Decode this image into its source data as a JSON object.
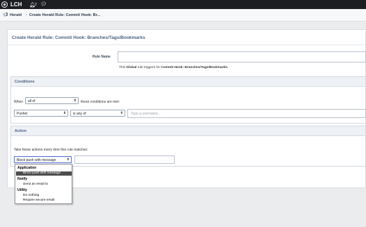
{
  "topbar": {
    "brand": "LCH",
    "notification_count": "2",
    "icons": {
      "logo": "eye-logo-icon",
      "bell": "bell-icon",
      "chat": "chat-icon"
    }
  },
  "breadcrumb": {
    "items": [
      "Herald",
      "Create Herald Rule: Commit Hook: Br..."
    ],
    "separator": "›"
  },
  "page": {
    "title": "Create Herald Rule: Commit Hook: Branches/Tags/Bookmarks"
  },
  "rule_name": {
    "label": "Rule Name",
    "value": "",
    "desc_prefix": "This ",
    "desc_scope": "Global",
    "desc_mid": " rule triggers for ",
    "desc_type": "Commit Hook: Branches/Tags/Bookmarks",
    "desc_end": "."
  },
  "conditions": {
    "header": "Conditions",
    "when_label": "When",
    "when_value": "all of",
    "when_suffix": "these conditions are met:",
    "field_value": "Pusher",
    "operator_value": "is any of",
    "token_placeholder": "Type a username..."
  },
  "action": {
    "header": "Action",
    "instructions": "Take these actions every time this rule matches:",
    "selected_action": "Block push with message",
    "message_value": "",
    "dropdown": [
      {
        "group": "Application",
        "options": [
          "Block push with message"
        ]
      },
      {
        "group": "Notify",
        "options": [
          "Send an email to"
        ]
      },
      {
        "group": "Utility",
        "options": [
          "Do nothing",
          "Require secure email"
        ]
      }
    ]
  },
  "colors": {
    "topbar": "#1c1e21",
    "header_text": "#4a6385",
    "selected_option_bg": "#4d4d4d",
    "focus_border": "#4a6bd6"
  }
}
